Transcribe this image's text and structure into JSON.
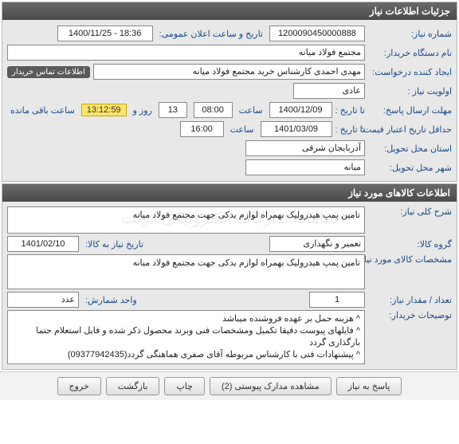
{
  "panel1": {
    "title": "جزئیات اطلاعات نیاز",
    "need_no_label": "شماره نیاز:",
    "need_no": "1200090450000888",
    "announce_label": "تاریخ و ساعت اعلان عمومی:",
    "announce_value": "1400/11/25 - 18:36",
    "buyer_label": "نام دستگاه خریدار:",
    "buyer_value": "مجتمع فولاد میانه",
    "creator_label": "ایجاد کننده درخواست:",
    "creator_value": "مهدی احمدی کارشناس خرید مجتمع فولاد میانه",
    "contact_chip": "اطلاعات تماس خریدار",
    "priority_label": "اولویت نیاز :",
    "priority_value": "عادی",
    "deadline_label": "مهلت ارسال پاسخ:",
    "to_date_label": "تا تاریخ :",
    "time_label": "ساعت",
    "deadline_date": "1400/12/09",
    "deadline_time": "08:00",
    "days_value": "13",
    "days_and": "روز و",
    "countdown": "13:12:59",
    "remaining": "ساعت باقی مانده",
    "validity_label": "حداقل تاریخ اعتبار قیمت:",
    "validity_date": "1401/03/09",
    "validity_time": "16:00",
    "province_label": "استان محل تحویل:",
    "province_value": "آذربایجان شرقی",
    "city_label": "شهر محل تحویل:",
    "city_value": "میانه"
  },
  "panel2": {
    "title": "اطلاعات کالاهای مورد نیاز",
    "desc_label": "شرح کلی نیاز:",
    "desc_value": "تامین پمپ هیدرولیک بهمراه لوازم یدکی جهت مجتمع فولاد میانه",
    "group_label": "گروه کالا:",
    "group_value": "تعمیر و نگهداری",
    "need_to_date_label": "تاریخ نیاز به کالا:",
    "need_to_date": "1401/02/10",
    "spec_label": "مشخصات کالای مورد نیاز:",
    "spec_value": "تامین پمپ هیدرولیک بهمراه لوازم یدکی جهت مجتمع فولاد میانه",
    "qty_label": "تعداد / مقدار نیاز:",
    "qty_value": "1",
    "unit_label": "واحد شمارش:",
    "unit_value": "عدد",
    "notes_label": "توضیحات خریدار:",
    "notes_value": "^ هزینه حمل بر عهده فروشنده میباشد\n^ فایلهای پیوست دقیقا تکمیل ومشخصات فنی وبرند محصول ذکر شده و فایل استعلام حتما بارگذاری گردد\n^ پیشنهادات فنی با کارشناس مربوطه آقای صفری هماهنگی گردد(09377942435)"
  },
  "buttons": {
    "respond": "پاسخ به نیاز",
    "attachments": "مشاهده مدارک پیوستی (2)",
    "print": "چاپ",
    "back": "بازگشت",
    "exit": "خروج"
  }
}
